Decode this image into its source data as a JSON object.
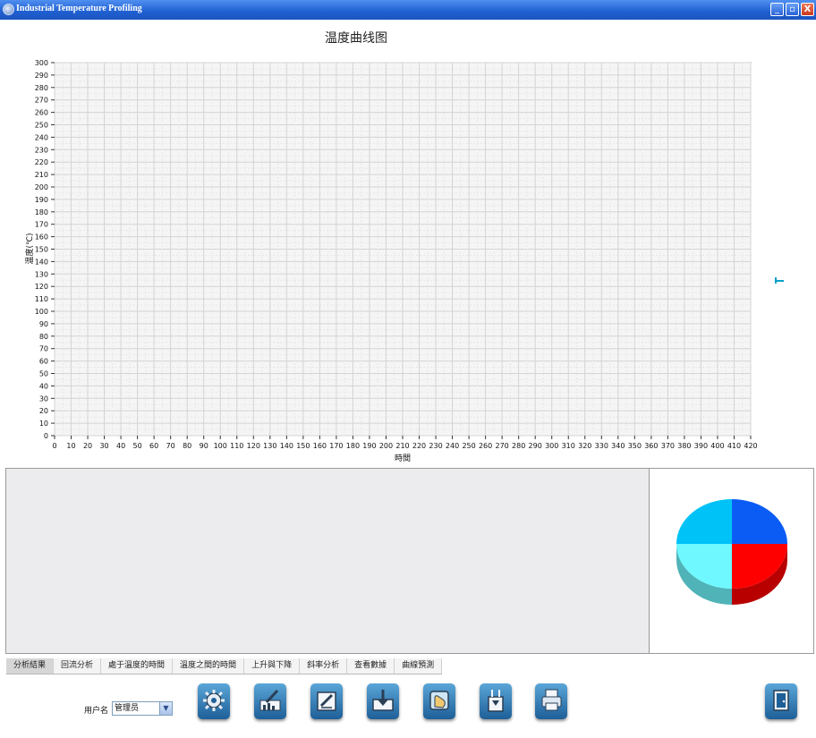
{
  "window": {
    "title": "Industrial Temperature Profiling",
    "minimize": "_",
    "maximize": "▫",
    "close": "X"
  },
  "chart_data": {
    "type": "line",
    "title": "温度曲线图",
    "xlabel": "時間",
    "ylabel": "温度(℃)",
    "xlim": [
      0,
      420
    ],
    "ylim": [
      0,
      300
    ],
    "x_ticks": [
      0,
      10,
      20,
      30,
      40,
      50,
      60,
      70,
      80,
      90,
      100,
      110,
      120,
      130,
      140,
      150,
      160,
      170,
      180,
      190,
      200,
      210,
      220,
      230,
      240,
      250,
      260,
      270,
      280,
      290,
      300,
      310,
      320,
      330,
      340,
      350,
      360,
      370,
      380,
      390,
      400,
      410,
      420
    ],
    "y_ticks": [
      0,
      10,
      20,
      30,
      40,
      50,
      60,
      70,
      80,
      90,
      100,
      110,
      120,
      130,
      140,
      150,
      160,
      170,
      180,
      190,
      200,
      210,
      220,
      230,
      240,
      250,
      260,
      270,
      280,
      290,
      300
    ],
    "grid": true,
    "series": []
  },
  "pie_chart": {
    "type": "pie",
    "style": "3d",
    "slices": [
      {
        "value": 25,
        "color": "#0a5cf5"
      },
      {
        "value": 25,
        "color": "#ff0000"
      },
      {
        "value": 25,
        "color": "#6ff8ff"
      },
      {
        "value": 25,
        "color": "#00c2f7"
      }
    ]
  },
  "tabs": [
    "分析結果",
    "回流分析",
    "處于溫度的時間",
    "溫度之間的時間",
    "上升與下降",
    "斜率分析",
    "查看數據",
    "曲線預測"
  ],
  "active_tab": 0,
  "user": {
    "label": "用户名",
    "value": "管理员"
  },
  "toolbar": [
    "settings-icon",
    "edit-chart-icon",
    "edit-document-icon",
    "download-icon",
    "hand-icon",
    "probe-icon",
    "print-icon",
    "exit-door-icon"
  ]
}
